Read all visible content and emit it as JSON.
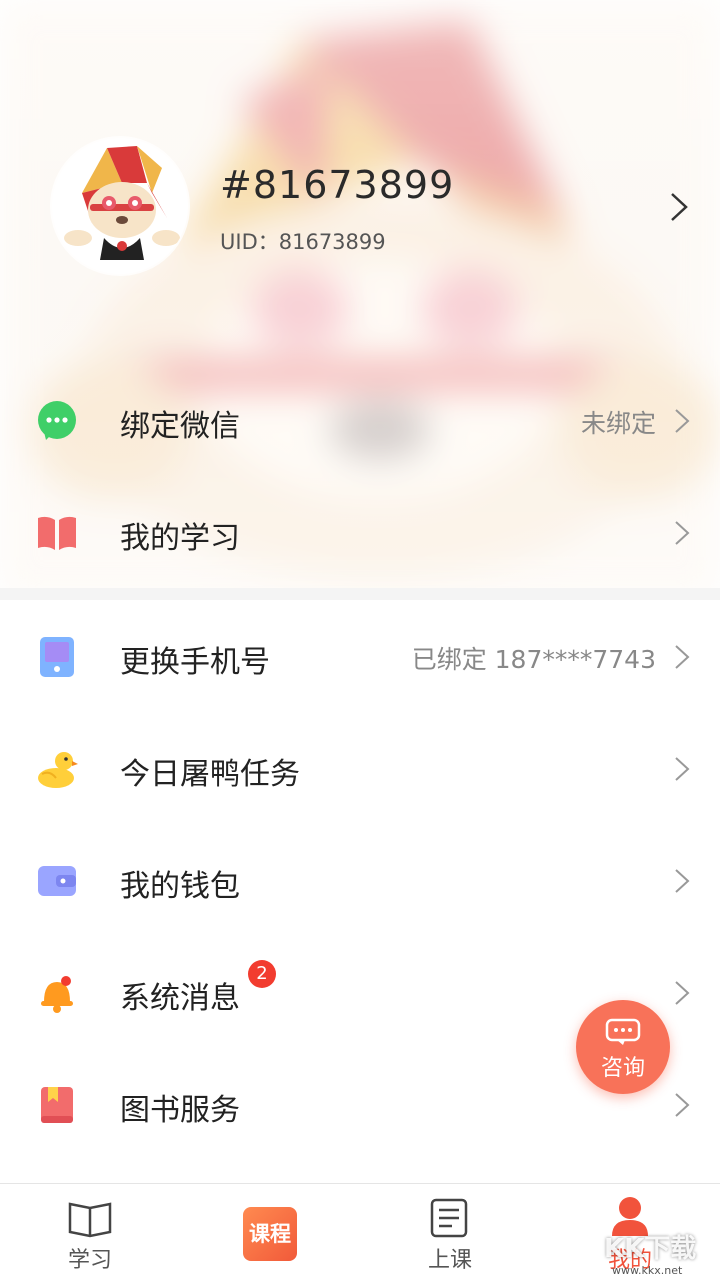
{
  "profile": {
    "name": "#81673899",
    "uid": "UID：81673899"
  },
  "menu": [
    {
      "label": "绑定微信",
      "value": "未绑定",
      "icon": "wechat-icon"
    },
    {
      "label": "我的学习",
      "value": "",
      "icon": "book-icon"
    },
    {
      "label": "更换手机号",
      "value": "已绑定 187****7743",
      "icon": "phone-icon"
    },
    {
      "label": "今日屠鸭任务",
      "value": "",
      "icon": "duck-icon"
    },
    {
      "label": "我的钱包",
      "value": "",
      "icon": "wallet-icon"
    },
    {
      "label": "系统消息",
      "value": "",
      "icon": "bell-icon",
      "badge": "2"
    },
    {
      "label": "图书服务",
      "value": "",
      "icon": "bookmark-book-icon"
    }
  ],
  "consult": {
    "label": "咨询"
  },
  "tabs": [
    {
      "label": "学习",
      "icon": "open-book-icon"
    },
    {
      "label": "课程",
      "icon": "course-icon"
    },
    {
      "label": "上课",
      "icon": "document-icon"
    },
    {
      "label": "我的",
      "icon": "user-icon"
    }
  ],
  "watermark": {
    "brand": "KK下载",
    "url": "www.kkx.net"
  },
  "colors": {
    "accent": "#f1533c",
    "consult": "#f87259",
    "badge": "#f23c2f",
    "wechat": "#3fcf68"
  }
}
